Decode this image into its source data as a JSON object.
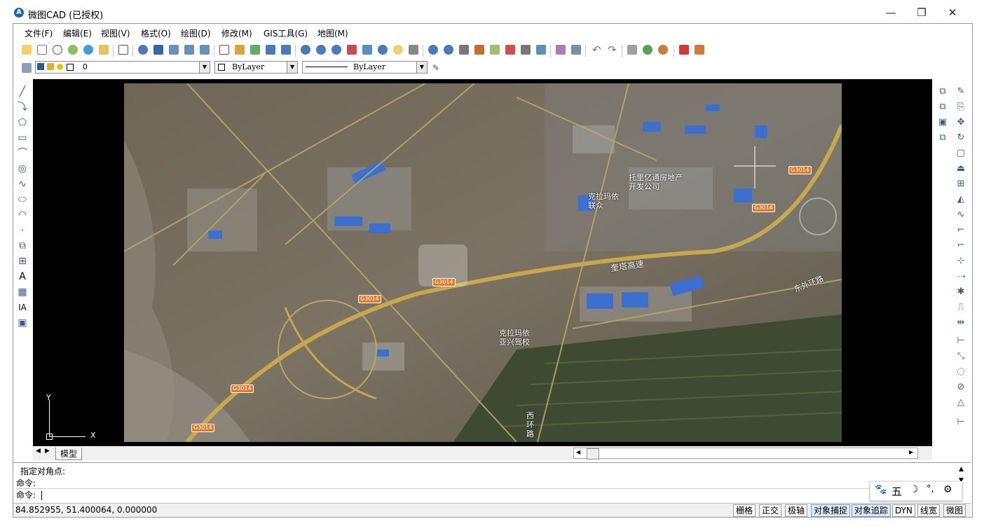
{
  "window": {
    "title": "微图CAD (已授权)",
    "icon_letter": "A",
    "minimize_glyph": "—",
    "maximize_glyph": "❐",
    "close_glyph": "✕"
  },
  "menu": [
    "文件(F)",
    "编辑(E)",
    "视图(V)",
    "格式(O)",
    "绘图(D)",
    "修改(M)",
    "GIS工具(G)",
    "地图(M)"
  ],
  "properties": {
    "layer_value": "0",
    "color_value": "ByLayer",
    "linetype_value": "ByLayer"
  },
  "map_labels": {
    "tuoli": "托里亿通房地产\n开发公司",
    "kelamayi_lianzhong": "克拉玛依\n联众",
    "kuita": "奎塔高速",
    "dongwai": "东外环路",
    "xihuan": "西环路",
    "kelamayi_yaxing": "克拉玛依\n亚兴驾校",
    "g3014_a": "G3014",
    "g3014_b": "G3014",
    "g3014_c": "G3014",
    "g3014_d": "G3014",
    "g3014_e": "G3014",
    "g3014_f": "G3014"
  },
  "ucs": {
    "x_label": "X",
    "y_label": "Y"
  },
  "tabs": {
    "model": "模型"
  },
  "command": {
    "line1": "指定对角点:",
    "line2": "命令:",
    "line3": "命令:"
  },
  "ime": {
    "brand": "五",
    "icon_paw": "🐾"
  },
  "status": {
    "coords": "84.852955,  51.400064,  0.000000",
    "buttons": [
      "栅格",
      "正交",
      "极轴",
      "对象捕捉",
      "对象追踪",
      "DYN",
      "线宽",
      "微图"
    ],
    "active": [
      3,
      4
    ]
  }
}
